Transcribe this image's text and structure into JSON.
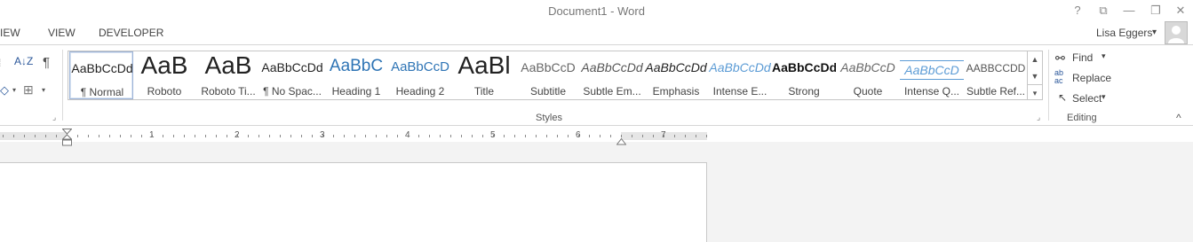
{
  "window": {
    "title": "Document1 - Word",
    "help_icon": "?",
    "restore_ribbon_icon": "⧉",
    "minimize_icon": "—",
    "maximize_icon": "❐",
    "close_icon": "✕"
  },
  "tabs": [
    {
      "label": "VIEW"
    },
    {
      "label": "VIEW"
    },
    {
      "label": "DEVELOPER"
    }
  ],
  "user": {
    "name": "Lisa Eggers",
    "dropdown": "▾"
  },
  "paragraph_group": {
    "sort_icon": "A↓Z",
    "pilcrow_icon": "¶",
    "shading_icon": "◇",
    "borders_icon": "⊞"
  },
  "styles": {
    "group_label": "Styles",
    "items": [
      {
        "sample": "AaBbCcDd",
        "label": "¶ Normal"
      },
      {
        "sample": "AaB",
        "label": "Roboto"
      },
      {
        "sample": "AaB",
        "label": "Roboto Ti..."
      },
      {
        "sample": "AaBbCcDd",
        "label": "¶ No Spac..."
      },
      {
        "sample": "AaBbC",
        "label": "Heading 1"
      },
      {
        "sample": "AaBbCcD",
        "label": "Heading 2"
      },
      {
        "sample": "AaBl",
        "label": "Title"
      },
      {
        "sample": "AaBbCcD",
        "label": "Subtitle"
      },
      {
        "sample": "AaBbCcDd",
        "label": "Subtle Em..."
      },
      {
        "sample": "AaBbCcDd",
        "label": "Emphasis"
      },
      {
        "sample": "AaBbCcDd",
        "label": "Intense E..."
      },
      {
        "sample": "AaBbCcDd",
        "label": "Strong"
      },
      {
        "sample": "AaBbCcD",
        "label": "Quote"
      },
      {
        "sample": "AaBbCcD",
        "label": "Intense Q..."
      },
      {
        "sample": "AABBCCDD",
        "label": "Subtle Ref..."
      }
    ],
    "scroll_up": "▲",
    "scroll_down": "▼",
    "more": "▾"
  },
  "editing": {
    "group_label": "Editing",
    "find": "Find",
    "find_dropdown": "▾",
    "replace": "Replace",
    "select": "Select",
    "select_dropdown": "▾",
    "collapse_icon": "^"
  },
  "ruler": {
    "numbers": [
      "1",
      "2",
      "3",
      "4",
      "5",
      "6",
      "7"
    ]
  },
  "colors": {
    "accent": "#2b579a",
    "heading_blue": "#2e74b5",
    "light_blue": "#5b9bd5"
  }
}
